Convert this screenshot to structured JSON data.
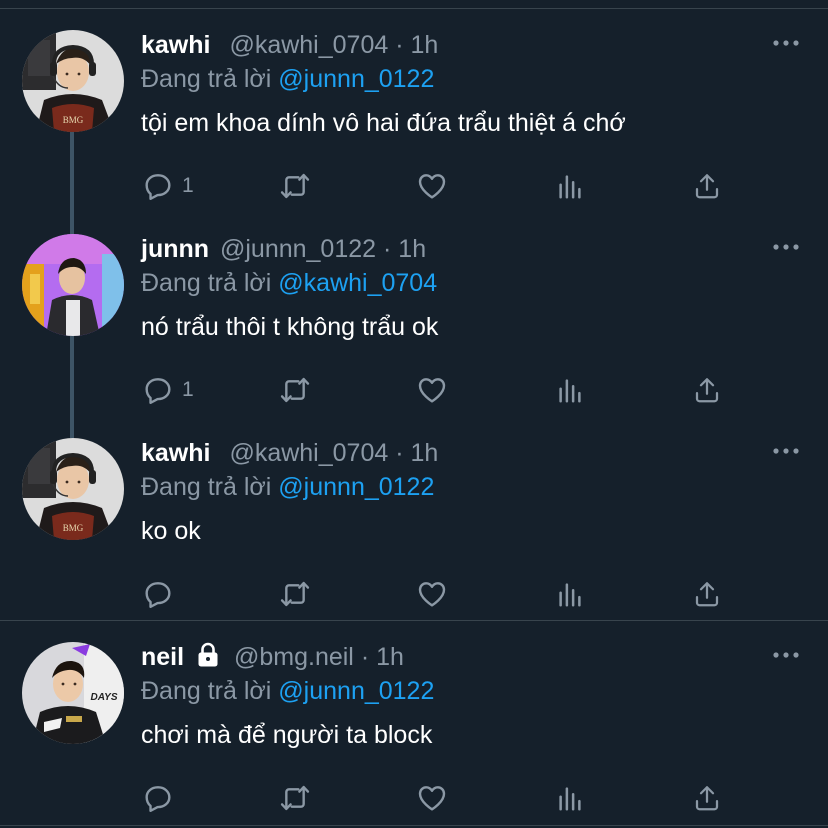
{
  "colors": {
    "background": "#15202b",
    "accent": "#1da1f2",
    "muted": "#8b98a5",
    "text": "#ffffff",
    "divider": "#38444d"
  },
  "icons": {
    "reply": "speech-bubble-icon",
    "retweet": "retweet-arrows-icon",
    "like": "heart-icon",
    "analytics": "bar-chart-icon",
    "share": "share-upload-icon",
    "more": "three-dots-icon",
    "protected": "lock-icon"
  },
  "tweets": [
    {
      "name": "kawhi",
      "handle": "@kawhi_0704",
      "dot": "·",
      "time": "1h",
      "reply_prefix": "Đang trả lời",
      "reply_to": "@junnn_0122",
      "text": "tội em khoa dính vô hai đứa trẩu thiệt á chớ",
      "reply_count": "1"
    },
    {
      "name": "junnn",
      "handle": "@junnn_0122",
      "dot": "·",
      "time": "1h",
      "reply_prefix": "Đang trả lời",
      "reply_to": "@kawhi_0704",
      "text": "nó trẩu thôi t không trẩu ok",
      "reply_count": "1"
    },
    {
      "name": "kawhi",
      "handle": "@kawhi_0704",
      "dot": "·",
      "time": "1h",
      "reply_prefix": "Đang trả lời",
      "reply_to": "@junnn_0122",
      "text": "ko ok",
      "reply_count": ""
    },
    {
      "name": "neil",
      "protected": true,
      "handle": "@bmg.neil",
      "dot": "·",
      "time": "1h",
      "reply_prefix": "Đang trả lời",
      "reply_to": "@junnn_0122",
      "text": "chơi mà để người ta block",
      "reply_count": ""
    }
  ]
}
